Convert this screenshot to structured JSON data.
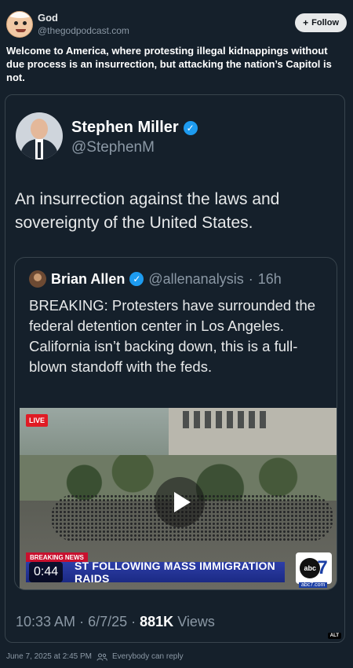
{
  "post": {
    "author_name": "God",
    "author_handle": "@thegodpodcast.com",
    "follow_label": "Follow",
    "text": "Welcome to America, where protesting illegal kidnappings without due process is an insurrection, but attacking the nation’s Capitol is not.",
    "posted_at": "June 7, 2025 at 2:45 PM",
    "reply_setting": "Everybody can reply"
  },
  "quoted": {
    "author_name": "Stephen Miller",
    "author_handle": "@StephenM",
    "text": "An insurrection against the laws and sovereignty of the United States.",
    "time": "10:33 AM",
    "date": "6/7/25",
    "views_count": "881K",
    "views_label": "Views",
    "alt_label": "ALT"
  },
  "nested_quote": {
    "author_name": "Brian Allen",
    "author_handle": "@allenanalysis",
    "age": "16h",
    "text": "BREAKING: Protesters have surrounded the federal detention center in Los Angeles. California isn’t backing down, this is a full-blown standoff with the feds.",
    "video": {
      "live_badge": "LIVE",
      "breaking_tag": "BREAKING NEWS",
      "chyron": "ST FOLLOWING MASS IMMIGRATION RAIDS",
      "duration": "0:44",
      "logo_text": "abc",
      "logo_number": "7",
      "logo_url": "abc7.com"
    }
  },
  "colors": {
    "background": "#15202b",
    "verified_blue": "#1d9bf0",
    "border": "#38444d",
    "muted_text": "#8b98a5"
  },
  "icons": [
    "verified-badge-icon",
    "plus-icon",
    "play-icon",
    "people-icon"
  ]
}
